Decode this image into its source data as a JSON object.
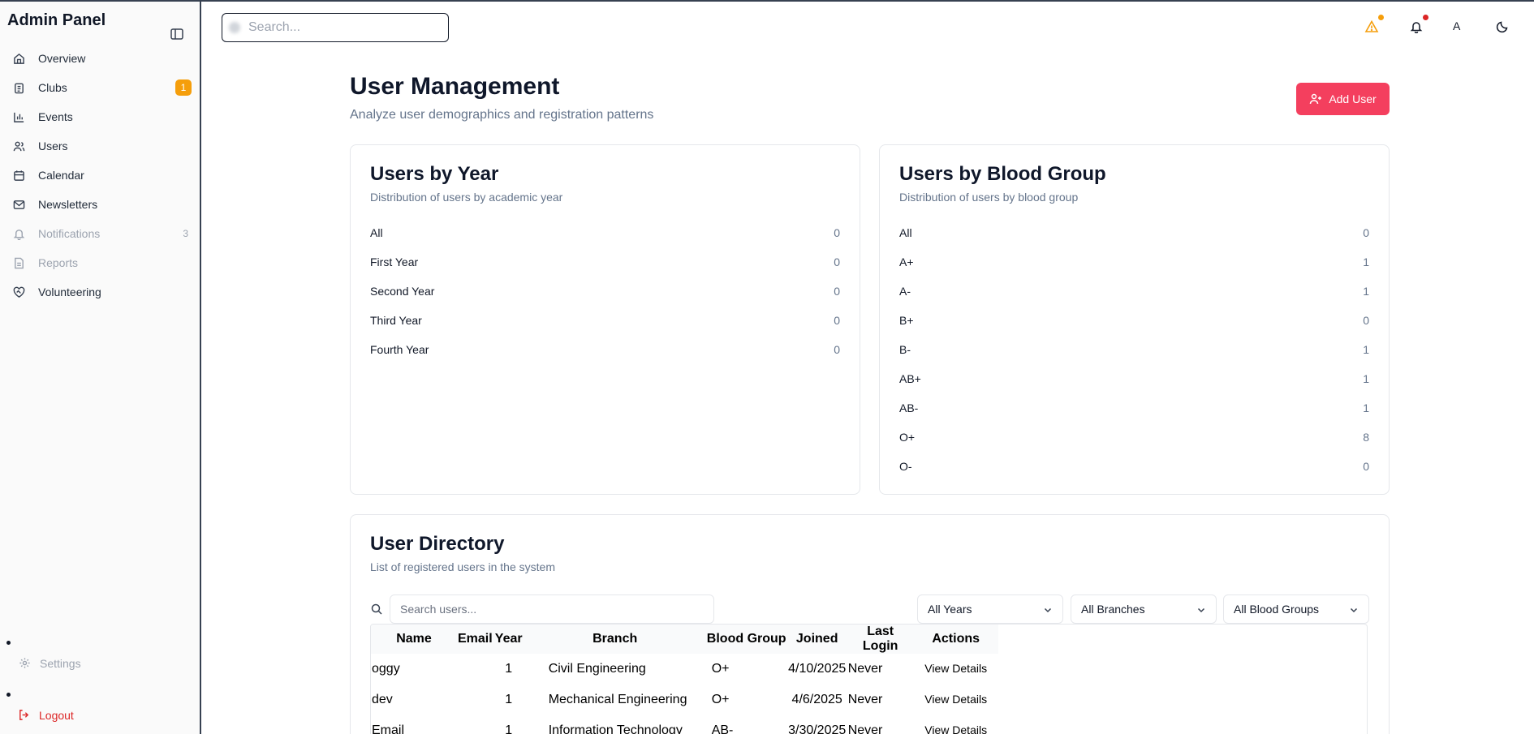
{
  "sidebar": {
    "title": "Admin Panel",
    "items": [
      {
        "label": "Overview",
        "icon": "home-icon"
      },
      {
        "label": "Clubs",
        "icon": "clipboard-icon",
        "badge": "1"
      },
      {
        "label": "Events",
        "icon": "bar-chart-icon"
      },
      {
        "label": "Users",
        "icon": "users-icon"
      },
      {
        "label": "Calendar",
        "icon": "calendar-icon"
      },
      {
        "label": "Newsletters",
        "icon": "mail-icon"
      },
      {
        "label": "Notifications",
        "icon": "bell-icon",
        "count": "3",
        "muted": true
      },
      {
        "label": "Reports",
        "icon": "file-text-icon",
        "muted": true
      },
      {
        "label": "Volunteering",
        "icon": "heart-handshake-icon"
      }
    ],
    "settings_label": "Settings",
    "logout_label": "Logout"
  },
  "topbar": {
    "search_placeholder": "Search...",
    "avatar_initial": "A"
  },
  "header": {
    "title": "User Management",
    "subtitle": "Analyze user demographics and registration patterns",
    "add_user_label": "Add User"
  },
  "year_card": {
    "title": "Users by Year",
    "subtitle": "Distribution of users by academic year",
    "rows": [
      {
        "label": "All",
        "value": "0"
      },
      {
        "label": "First Year",
        "value": "0"
      },
      {
        "label": "Second Year",
        "value": "0"
      },
      {
        "label": "Third Year",
        "value": "0"
      },
      {
        "label": "Fourth Year",
        "value": "0"
      }
    ]
  },
  "blood_card": {
    "title": "Users by Blood Group",
    "subtitle": "Distribution of users by blood group",
    "rows": [
      {
        "label": "All",
        "value": "0"
      },
      {
        "label": "A+",
        "value": "1"
      },
      {
        "label": "A-",
        "value": "1"
      },
      {
        "label": "B+",
        "value": "0"
      },
      {
        "label": "B-",
        "value": "1"
      },
      {
        "label": "AB+",
        "value": "1"
      },
      {
        "label": "AB-",
        "value": "1"
      },
      {
        "label": "O+",
        "value": "8"
      },
      {
        "label": "O-",
        "value": "0"
      }
    ]
  },
  "directory": {
    "title": "User Directory",
    "subtitle": "List of registered users in the system",
    "search_placeholder": "Search users...",
    "filters": {
      "years": "All Years",
      "branches": "All Branches",
      "blood_groups": "All Blood Groups"
    },
    "columns": [
      "Name",
      "Email",
      "Year",
      "Branch",
      "Blood Group",
      "Joined",
      "Last Login",
      "Actions"
    ],
    "rows": [
      {
        "name": "oggy",
        "email": "",
        "year": "1",
        "branch": "Civil Engineering",
        "blood": "O+",
        "joined": "4/10/2025",
        "last_login": "Never",
        "action": "View Details"
      },
      {
        "name": "dev",
        "email": "",
        "year": "1",
        "branch": "Mechanical Engineering",
        "blood": "O+",
        "joined": "4/6/2025",
        "last_login": "Never",
        "action": "View Details"
      },
      {
        "name": "Email",
        "email": "",
        "year": "1",
        "branch": "Information Technology",
        "blood": "AB-",
        "joined": "3/30/2025",
        "last_login": "Never",
        "action": "View Details"
      }
    ]
  },
  "colors": {
    "accent": "#f43f5e",
    "badge": "#f59e0b",
    "alert": "#dc2626"
  }
}
